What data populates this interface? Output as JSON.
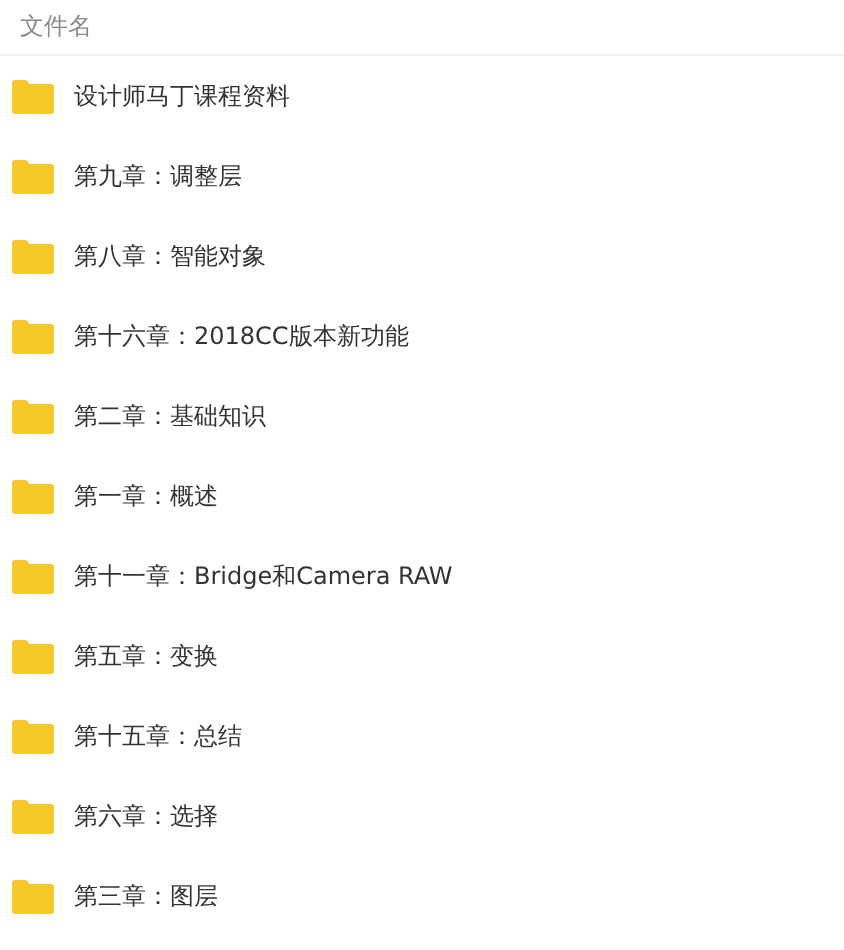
{
  "header": {
    "label": "文件名"
  },
  "files": [
    {
      "name": "设计师马丁课程资料"
    },
    {
      "name": "第九章：调整层"
    },
    {
      "name": "第八章：智能对象"
    },
    {
      "name": "第十六章：2018CC版本新功能"
    },
    {
      "name": "第二章：基础知识"
    },
    {
      "name": "第一章：概述"
    },
    {
      "name": "第十一章：Bridge和Camera RAW"
    },
    {
      "name": "第五章：变换"
    },
    {
      "name": "第十五章：总结"
    },
    {
      "name": "第六章：选择"
    },
    {
      "name": "第三章：图层"
    }
  ]
}
